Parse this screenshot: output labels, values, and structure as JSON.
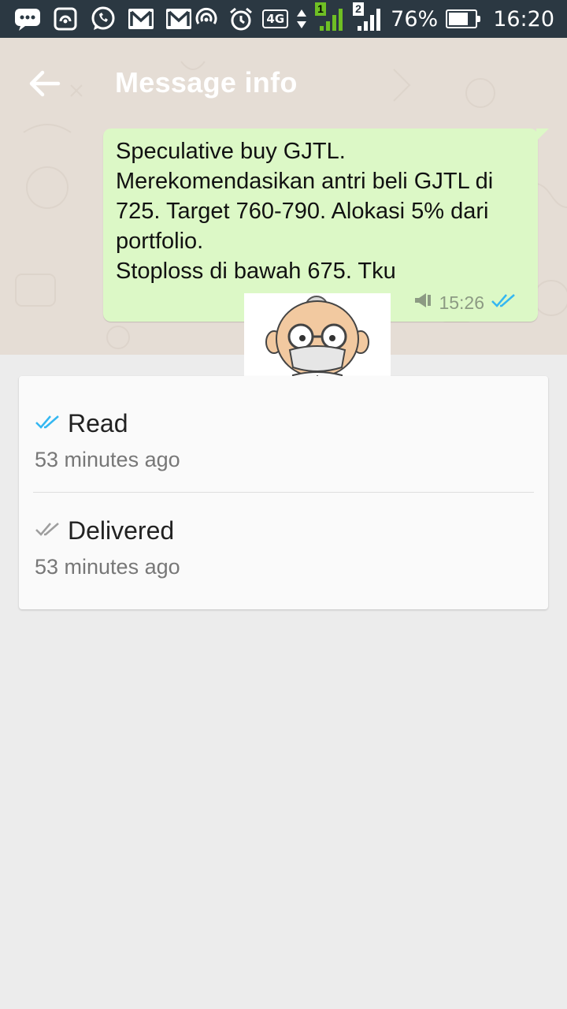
{
  "status_bar": {
    "network": "4G",
    "sim1": "1",
    "sim2": "2",
    "battery": "76%",
    "battery_fraction": 0.76,
    "time": "16:20"
  },
  "header": {
    "title": "Message info"
  },
  "message": {
    "text": "Speculative buy GJTL.\nMerekomendasikan antri beli GJTL di 725. Target 760-790. Alokasi 5% dari portfolio.\nStoploss di bawah 675. Tku",
    "time": "15:26"
  },
  "receipts": [
    {
      "label": "Read",
      "time": "53 minutes ago",
      "check_color": "#34b7f1"
    },
    {
      "label": "Delivered",
      "time": "53 minutes ago",
      "check_color": "#9e9e9e"
    }
  ],
  "colors": {
    "status_bar_bg": "#2b3842",
    "bubble_bg": "#dcf8c6",
    "read_tick": "#34b7f1"
  }
}
